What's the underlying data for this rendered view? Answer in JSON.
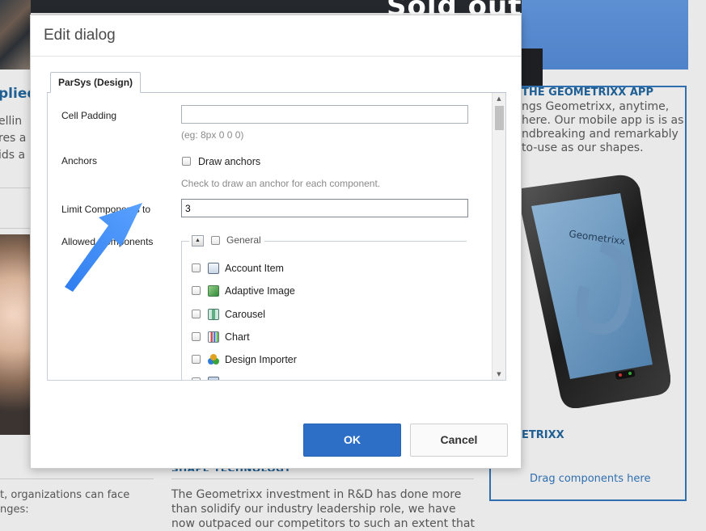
{
  "background": {
    "banner_text": "Sold out!",
    "left_title": "plied",
    "left_text": "ellin\nres a\nids a",
    "bottom_left_text": "t, organizations can face\nnges:",
    "mid_heading": "SHAPE TECHNOLOGY",
    "mid_text": "The Geometrixx investment in R&D has done more\nthan solidify our industry leadership role, we have\nnow outpaced our competitors to such an extent that",
    "app_title": "THE GEOMETRIXX APP",
    "app_text": "ngs Geometrixx, anytime,\nhere. Our mobile app is is as\nndbreaking and remarkably\nto-use as our shapes.",
    "phone_brand": "Geometrixx",
    "phone_caption": "ETRIXX",
    "drag_text": "Drag components here"
  },
  "dialog": {
    "title": "Edit dialog",
    "tab_label": "ParSys (Design)",
    "fields": {
      "cell_padding_label": "Cell Padding",
      "cell_padding_value": "",
      "cell_padding_hint": "(eg: 8px 0 0 0)",
      "anchors_label": "Anchors",
      "draw_anchors_label": "Draw anchors",
      "anchors_hint": "Check to draw an anchor for each component.",
      "limit_label": "Limit Components to",
      "limit_value": "3",
      "allowed_label": "Allowed Components"
    },
    "group_name": "General",
    "components": [
      {
        "label": "Account Item",
        "icon": "account-item-icon"
      },
      {
        "label": "Adaptive Image",
        "icon": "image-icon"
      },
      {
        "label": "Carousel",
        "icon": "carousel-icon"
      },
      {
        "label": "Chart",
        "icon": "chart-icon"
      },
      {
        "label": "Design Importer",
        "icon": "design-importer-icon"
      }
    ],
    "ok_label": "OK",
    "cancel_label": "Cancel"
  },
  "colors": {
    "primary_button": "#2d6fc7",
    "link_blue": "#1f5f93",
    "annotation_arrow": "#2d7ff2"
  }
}
